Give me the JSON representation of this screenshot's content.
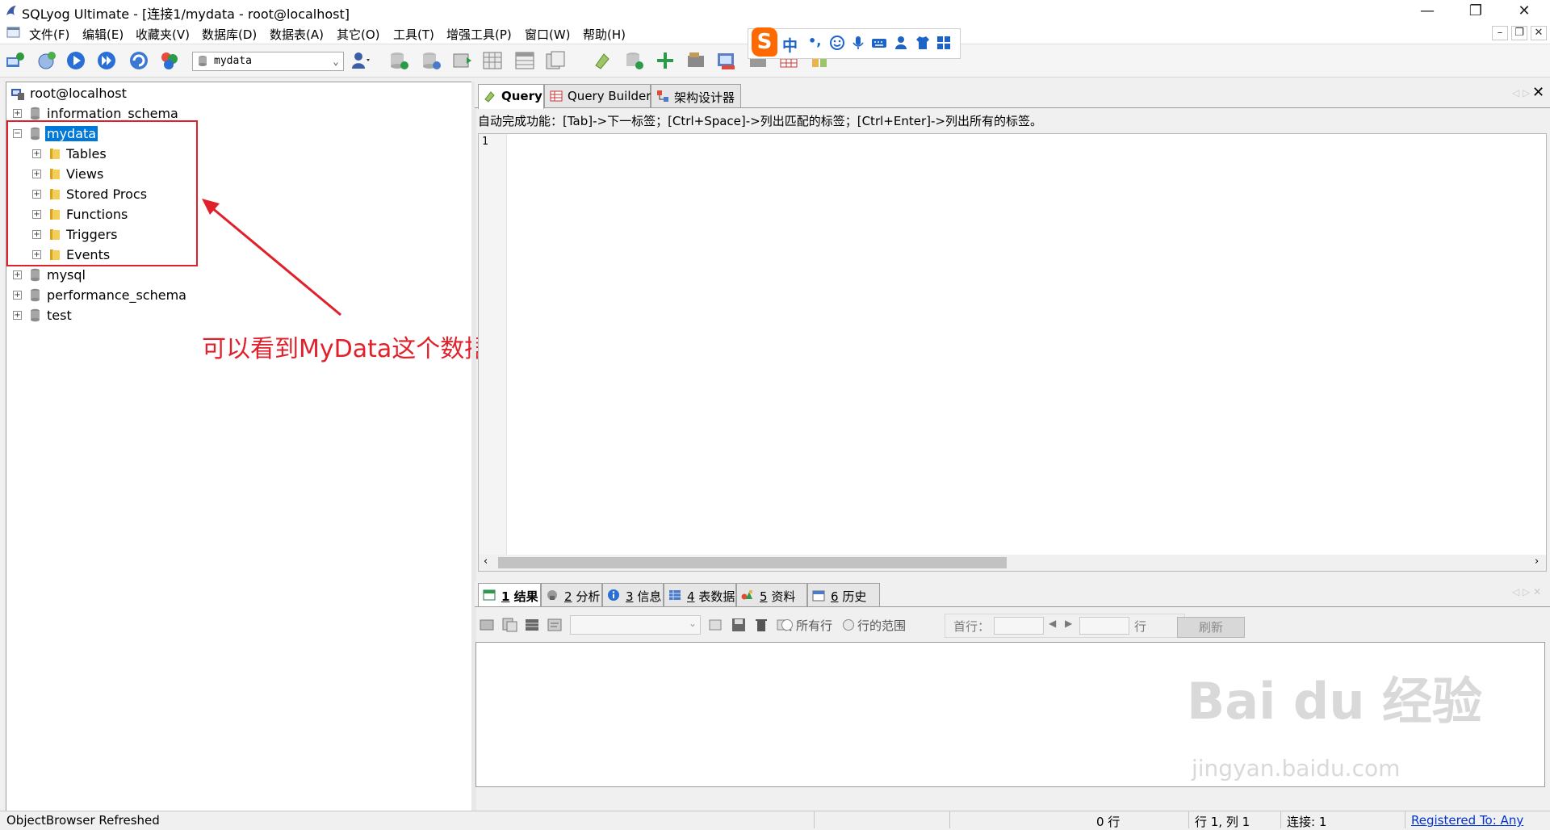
{
  "window": {
    "title": "SQLyog Ultimate - [连接1/mydata - root@localhost]",
    "controls": {
      "minimize": "—",
      "restore": "❐",
      "close": "✕"
    }
  },
  "menu": [
    "文件(F)",
    "编辑(E)",
    "收藏夹(V)",
    "数据库(D)",
    "数据表(A)",
    "其它(O)",
    "工具(T)",
    "增强工具(P)",
    "窗口(W)",
    "帮助(H)"
  ],
  "toolbar": {
    "database_selector": "mydata"
  },
  "ime": {
    "logo": "S",
    "mode": "中",
    "punct": "•,"
  },
  "object_browser": {
    "root": "root@localhost",
    "databases": [
      {
        "name": "information_schema",
        "expanded": false
      },
      {
        "name": "mydata",
        "expanded": true,
        "selected": true,
        "children": [
          "Tables",
          "Views",
          "Stored Procs",
          "Functions",
          "Triggers",
          "Events"
        ]
      },
      {
        "name": "mysql",
        "expanded": false
      },
      {
        "name": "performance_schema",
        "expanded": false
      },
      {
        "name": "test",
        "expanded": false
      }
    ]
  },
  "annotation": {
    "text": "可以看到MyData这个数据库就创建好了",
    "color": "#e0202a"
  },
  "editor_tabs": [
    {
      "label": "Query",
      "active": true
    },
    {
      "label": "Query Builder",
      "active": false
    },
    {
      "label": "架构设计器",
      "active": false
    }
  ],
  "autocomplete_hint": "自动完成功能：[Tab]->下一标签；[Ctrl+Space]->列出匹配的标签；[Ctrl+Enter]->列出所有的标签。",
  "editor": {
    "line_numbers": [
      "1"
    ]
  },
  "result_tabs": [
    {
      "num": "1",
      "label": "结果",
      "active": true
    },
    {
      "num": "2",
      "label": "分析",
      "active": false
    },
    {
      "num": "3",
      "label": "信息",
      "active": false
    },
    {
      "num": "4",
      "label": "表数据",
      "active": false
    },
    {
      "num": "5",
      "label": "资料",
      "active": false
    },
    {
      "num": "6",
      "label": "历史",
      "active": false
    }
  ],
  "result_toolbar": {
    "all_rows": "所有行",
    "row_range": "行的范围",
    "first_row": "首行：",
    "rows": "行",
    "refresh": "刷新"
  },
  "statusbar": {
    "message": "ObjectBrowser Refreshed",
    "rows": "0 行",
    "position": "行 1, 列 1",
    "connections": "连接: 1",
    "registered": "Registered To: Any"
  },
  "watermark": {
    "main": "Bai du 经验",
    "sub": "jingyan.baidu.com"
  },
  "colors": {
    "selection": "#0078d7",
    "annotation": "#e0202a",
    "ime_logo": "#ff6a00",
    "link": "#0033cc"
  }
}
